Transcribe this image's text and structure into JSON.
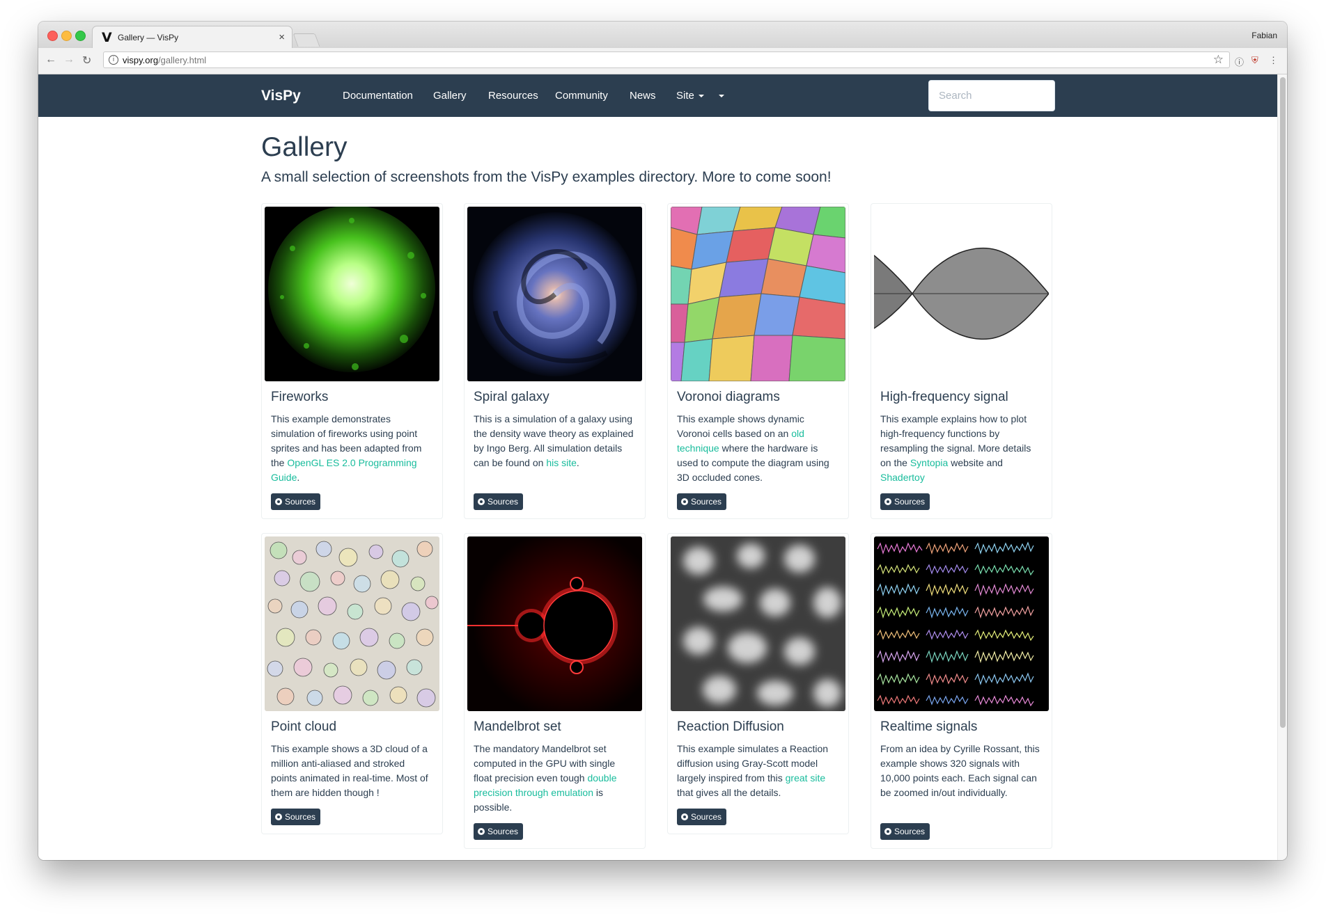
{
  "browser": {
    "tab_title": "Gallery — VisPy",
    "tab_favicon": "V",
    "tab_close": "×",
    "profile_name": "Fabian",
    "url_host": "vispy.org",
    "url_path": "/gallery.html"
  },
  "navbar": {
    "brand": "VisPy",
    "links": [
      "Documentation",
      "Gallery",
      "Resources",
      "Community",
      "News",
      "Site"
    ],
    "search_placeholder": "Search"
  },
  "page": {
    "title": "Gallery",
    "lead": "A small selection of screenshots from the VisPy examples directory. More to come soon!"
  },
  "sources_label": "Sources",
  "cards": [
    {
      "title": "Fireworks",
      "desc": [
        {
          "text": "This example demonstrates simulation of fireworks using point sprites and has been adapted from the "
        },
        {
          "text": "OpenGL ES 2.0 Programming Guide",
          "link": true
        },
        {
          "text": "."
        }
      ]
    },
    {
      "title": "Spiral galaxy",
      "desc": [
        {
          "text": "This is a simulation of a galaxy using the density wave theory as explained by Ingo Berg. All simulation details can be found on "
        },
        {
          "text": "his site",
          "link": true
        },
        {
          "text": "."
        }
      ]
    },
    {
      "title": "Voronoi diagrams",
      "desc": [
        {
          "text": "This example shows dynamic Voronoi cells based on an "
        },
        {
          "text": "old technique",
          "link": true
        },
        {
          "text": " where the hardware is used to compute the diagram using 3D occluded cones."
        }
      ]
    },
    {
      "title": "High-frequency signal",
      "desc": [
        {
          "text": "This example explains how to plot high-frequency functions by resampling the signal. More details on the "
        },
        {
          "text": "Syntopia",
          "link": true
        },
        {
          "text": " website and "
        },
        {
          "text": "Shadertoy",
          "link": true
        }
      ]
    },
    {
      "title": "Point cloud",
      "desc": [
        {
          "text": "This example shows a 3D cloud of a million anti-aliased and stroked points animated in real-time. Most of them are hidden though !"
        }
      ]
    },
    {
      "title": "Mandelbrot set",
      "desc": [
        {
          "text": "The mandatory Mandelbrot set computed in the GPU with single float precision even tough "
        },
        {
          "text": "double precision through emulation",
          "link": true
        },
        {
          "text": " is possible."
        }
      ]
    },
    {
      "title": "Reaction Diffusion",
      "desc": [
        {
          "text": "This example simulates a Reaction diffusion using Gray-Scott model largely inspired from this "
        },
        {
          "text": "great site",
          "link": true
        },
        {
          "text": " that gives all the details."
        }
      ]
    },
    {
      "title": "Realtime signals",
      "desc": [
        {
          "text": "From an idea by Cyrille Rossant, this example shows 320 signals with 10,000 points each. Each signal can be zoomed in/out individually."
        }
      ]
    }
  ],
  "colors": {
    "navbar_bg": "#2c3e50",
    "link": "#18bc9c",
    "text": "#2c3e50"
  },
  "icons": [
    "info-icon",
    "bookmark-star-icon",
    "back-arrow-icon",
    "forward-arrow-icon",
    "reload-icon",
    "github-icon",
    "caret-down-icon"
  ]
}
